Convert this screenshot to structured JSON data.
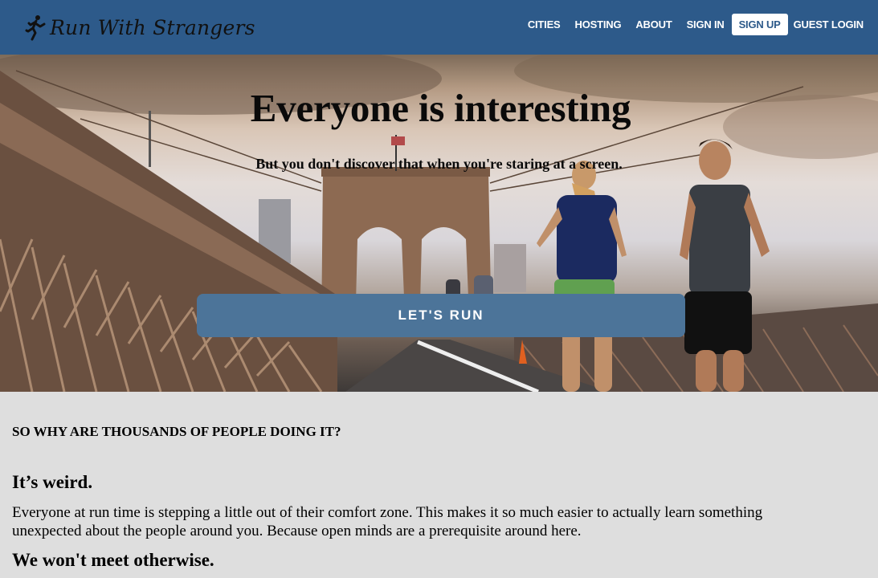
{
  "brand": {
    "name": "Run With Strangers",
    "icon": "runner-icon"
  },
  "nav": {
    "items": [
      {
        "label": "CITIES"
      },
      {
        "label": "HOSTING"
      },
      {
        "label": "ABOUT"
      },
      {
        "label": "SIGN IN"
      },
      {
        "label": "SIGN UP"
      },
      {
        "label": "GUEST LOGIN"
      }
    ]
  },
  "hero": {
    "title": "Everyone is interesting",
    "subtitle": "But you don't discover that when you're staring at a screen.",
    "cta_label": "LET'S RUN",
    "image": "runners-on-brooklyn-bridge"
  },
  "content": {
    "kicker": "SO WHY ARE THOUSANDS OF PEOPLE DOING IT?",
    "reasons": [
      {
        "title": "It’s weird.",
        "body": "Everyone at run time is stepping a little out of their comfort zone. This makes it so much easier to actually learn something unexpected about the people around you. Because open minds are a prerequisite around here."
      },
      {
        "title": "We won't meet otherwise."
      }
    ]
  },
  "colors": {
    "navbar": "#2d5a8a",
    "cta": "#4c7499",
    "page_background": "#dedede"
  }
}
